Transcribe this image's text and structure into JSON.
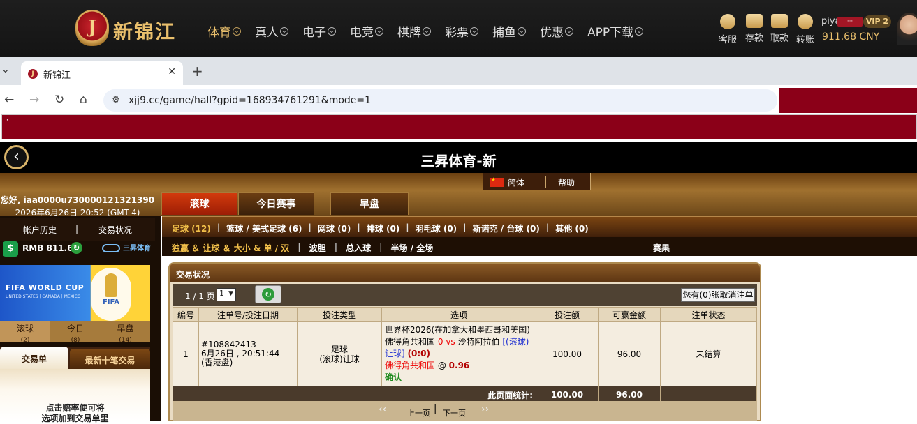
{
  "site": {
    "logo_text": "新锦江",
    "logo_mark": "J",
    "nav": [
      {
        "label": "体育",
        "active": true
      },
      {
        "label": "真人"
      },
      {
        "label": "电子"
      },
      {
        "label": "电竞"
      },
      {
        "label": "棋牌"
      },
      {
        "label": "彩票"
      },
      {
        "label": "捕鱼"
      },
      {
        "label": "优惠"
      },
      {
        "label": "APP下载"
      }
    ],
    "wallet_actions": [
      "客服",
      "存款",
      "取款",
      "转账"
    ],
    "user_name": "piya",
    "user_mask": "···",
    "vip": "VIP 2",
    "balance": "911.68 CNY"
  },
  "browser": {
    "tab_title": "新锦江",
    "url": "xjj9.cc/game/hall?gpid=168934761291&mode=1",
    "redbar_text": "'"
  },
  "app": {
    "title": "三昇体育-新",
    "lang": "简体",
    "help": "帮助",
    "greeting": "您好, iaa0000u730000121321390",
    "time": "2026年6月26日 20:52 (GMT-4)",
    "main_tabs": [
      "滚球",
      "今日赛事",
      "早盘"
    ],
    "account_history": "帐户历史",
    "sep": "|",
    "bet_status": "交易状况",
    "rmb": "RMB 811.68",
    "brand": "三昇体育",
    "fifa_title": "FIFA WORLD CUP",
    "fifa_sub": "UNITED STATES | CANADA | MÉXICO",
    "fifa_mark": "FIFA",
    "live_tabs": [
      {
        "label": "滚球",
        "count": "(2)"
      },
      {
        "label": "今日",
        "count": "(8)"
      },
      {
        "label": "早盘",
        "count": "(14)"
      }
    ],
    "slip_tab": "交易单",
    "last_tab": "最新十笔交易",
    "slip_hint_1": "点击赔率便可将",
    "slip_hint_2": "选项加到交易单里"
  },
  "sports": [
    {
      "label": "足球 (12)",
      "active": true
    },
    {
      "label": "篮球 / 美式足球 (6)"
    },
    {
      "label": "网球 (0)"
    },
    {
      "label": "排球 (0)"
    },
    {
      "label": "羽毛球 (0)"
    },
    {
      "label": "斯诺克 / 台球 (0)"
    },
    {
      "label": "其他 (0)"
    }
  ],
  "bet_types": [
    {
      "label": "独赢 ＆ 让球 ＆ 大小 & 单 / 双",
      "active": true
    },
    {
      "label": "波胆"
    },
    {
      "label": "总入球"
    },
    {
      "label": "半场 / 全场"
    }
  ],
  "results": "赛果",
  "panel": {
    "title": "交易状况",
    "page_label": "1 / 1 页",
    "page_select": "1",
    "cancel_button": "您有(0)张取消注单",
    "headers": [
      "编号",
      "注单号/投注日期",
      "投注类型",
      "选项",
      "投注额",
      "可赢金额",
      "注单状态"
    ],
    "row": {
      "no": "1",
      "ticket": "#108842413",
      "date": "6月26日 , 20:51:44",
      "zone": "(香港盘)",
      "type_1": "足球",
      "type_2": "(滚球)让球",
      "league": "世界杯2026(在加拿大和墨西哥和美国)",
      "home": "佛得角共和国",
      "home_score": "0",
      "vs": "vs",
      "away": "沙特阿拉伯",
      "live_tag": "[(滚球)",
      "live_tag2": "让球]",
      "score": "(0:0)",
      "pick": "佛得角共和国",
      "at": "@",
      "odds": "0.96",
      "confirm": "确认",
      "stake": "100.00",
      "win": "96.00",
      "status": "未结算"
    },
    "total_label": "此页面统计:",
    "total_stake": "100.00",
    "total_win": "96.00",
    "prev": "上一页",
    "next": "下一页",
    "prev_arrow": "‹‹",
    "next_arrow": "››",
    "divider": "|"
  }
}
